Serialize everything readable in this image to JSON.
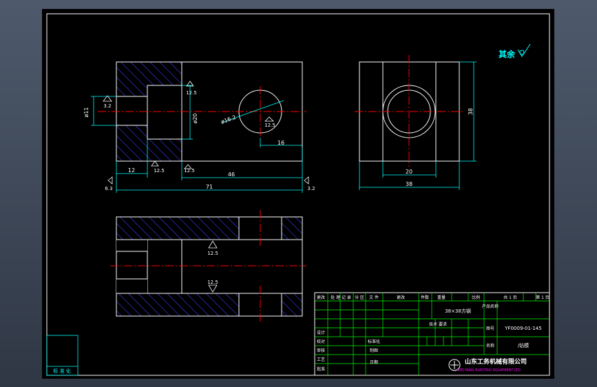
{
  "colors": {
    "background": "#000000",
    "frame": "#ffffff",
    "centerline": "#ff0000",
    "dimension": "#00ffff",
    "hatch": "#3c3cff",
    "title_block": "#00ff00",
    "roughness": "#00ffff",
    "company_en": "#ff00ff"
  },
  "roughness_note": {
    "label": "其余"
  },
  "front_view": {
    "dims": {
      "d_11": "ø11",
      "d_20": "ø20",
      "d_16_2": "ø16.2",
      "len_16": "16",
      "len_12": "12",
      "len_46": "46",
      "len_71": "71"
    },
    "roughness": {
      "r1": "3.2",
      "r2": "12.5",
      "r3": "12.5",
      "r4": "12.5",
      "r5": "12.5",
      "r6": "6.3",
      "r7": "3.2"
    }
  },
  "side_view": {
    "dims": {
      "height_38": "38",
      "width_20": "20",
      "width_38": "38"
    }
  },
  "bottom_view": {
    "roughness": {
      "r1": "12.5",
      "r2": "12.5"
    }
  },
  "title_block": {
    "header": [
      "更改",
      "处 理 记 录",
      "分 区",
      "文 件",
      "更改",
      "",
      "",
      "",
      "",
      "共 1 页",
      "第 1 页"
    ],
    "material": "38×38方钢",
    "drawing_no": "YF0009-01-145",
    "part_name": "/钻模",
    "labels": {
      "count": "件数",
      "weight": "重量",
      "ratio": "比例",
      "product_name": "产品名称",
      "design": "设计",
      "proofread": "校对",
      "review": "审核",
      "standard": "标准化",
      "process": "工艺",
      "approve": "批准",
      "date": "日期",
      "draw": "制图",
      "drawing_no_label": "图号",
      "part_label": "名称",
      "tech_req": "技术 要求"
    },
    "company_cn": "山东工务机械有限公司",
    "company_en": "WEI FANG ELECTRIC EQUIPMENT LTD"
  },
  "corner_box": {
    "label": "标 准 化"
  }
}
